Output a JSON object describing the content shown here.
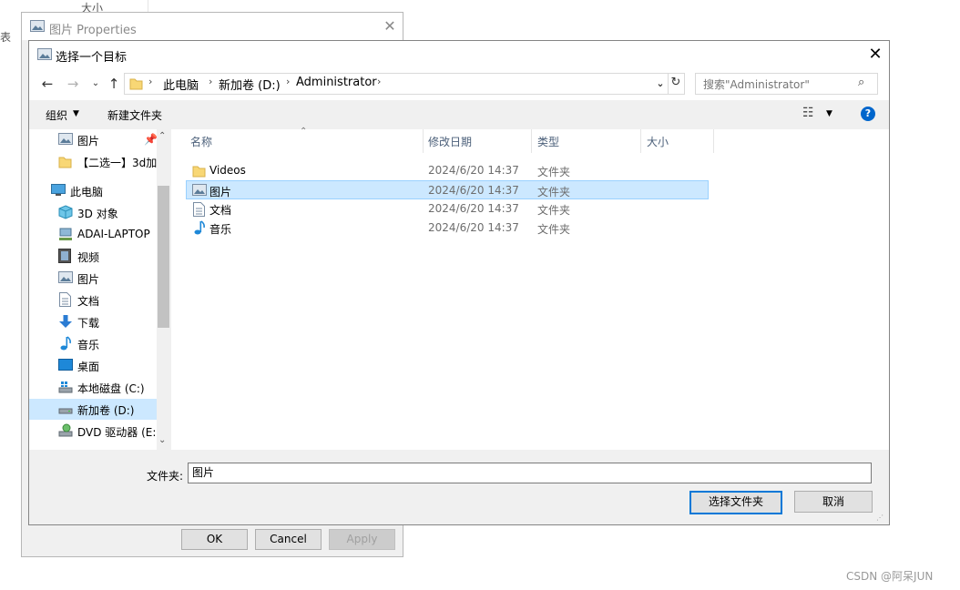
{
  "background": {
    "left_edge_text": "表",
    "top_header_text": "大小"
  },
  "properties_window": {
    "title": "图片 Properties",
    "close": "✕",
    "buttons": {
      "ok": "OK",
      "cancel": "Cancel",
      "apply": "Apply"
    }
  },
  "dialog": {
    "title": "选择一个目标",
    "close": "✕",
    "address": {
      "crumbs": [
        "此电脑",
        "新加卷 (D:)",
        "Administrator"
      ],
      "search_placeholder": "搜索\"Administrator\""
    },
    "toolbar": {
      "organize": "组织",
      "new_folder": "新建文件夹"
    },
    "sidebar": {
      "items": [
        {
          "label": "图片",
          "icon": "pictures-icon",
          "pinned": true
        },
        {
          "label": "【二选一】3d加",
          "icon": "folder-icon"
        },
        {
          "label": "此电脑",
          "icon": "computer-icon"
        },
        {
          "label": "3D 对象",
          "icon": "3d-objects-icon"
        },
        {
          "label": "ADAI-LAPTOP",
          "icon": "network-pc-icon"
        },
        {
          "label": "视频",
          "icon": "video-icon"
        },
        {
          "label": "图片",
          "icon": "pictures-icon"
        },
        {
          "label": "文档",
          "icon": "document-icon"
        },
        {
          "label": "下载",
          "icon": "download-icon"
        },
        {
          "label": "音乐",
          "icon": "music-icon"
        },
        {
          "label": "桌面",
          "icon": "desktop-icon"
        },
        {
          "label": "本地磁盘 (C:)",
          "icon": "drive-c-icon"
        },
        {
          "label": "新加卷 (D:)",
          "icon": "drive-d-icon",
          "selected": true
        },
        {
          "label": "DVD 驱动器 (E:)",
          "icon": "dvd-drive-icon"
        }
      ]
    },
    "columns": {
      "name": "名称",
      "modified": "修改日期",
      "type": "类型",
      "size": "大小"
    },
    "files": [
      {
        "name": "Videos",
        "modified": "2024/6/20 14:37",
        "type": "文件夹",
        "icon": "folder-icon"
      },
      {
        "name": "图片",
        "modified": "2024/6/20 14:37",
        "type": "文件夹",
        "icon": "pictures-icon",
        "selected": true
      },
      {
        "name": "文档",
        "modified": "2024/6/20 14:37",
        "type": "文件夹",
        "icon": "document-icon"
      },
      {
        "name": "音乐",
        "modified": "2024/6/20 14:37",
        "type": "文件夹",
        "icon": "music-icon"
      }
    ],
    "footer": {
      "folder_label": "文件夹:",
      "folder_value": "图片",
      "select_button": "选择文件夹",
      "cancel_button": "取消"
    }
  },
  "watermark": "CSDN @阿呆JUN",
  "colors": {
    "selection": "#cce8ff",
    "accent": "#0078d7"
  }
}
